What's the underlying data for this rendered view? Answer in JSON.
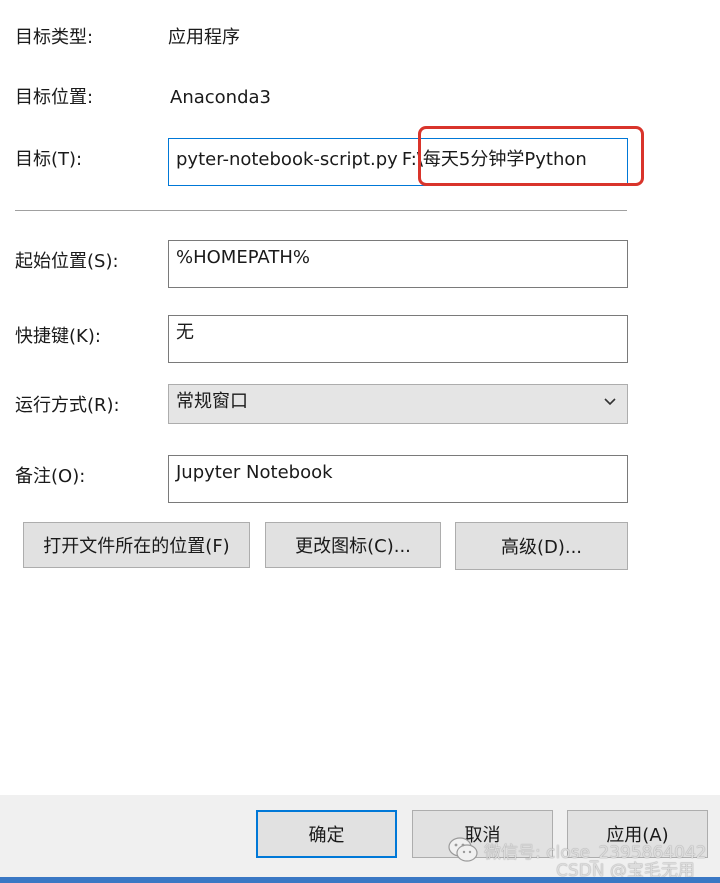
{
  "properties": {
    "target_type_label": "目标类型:",
    "target_type_value": "应用程序",
    "target_location_label": "目标位置:",
    "target_location_value": "Anaconda3",
    "target_label": "目标(T):",
    "target_value_left": "pyter-notebook-script.py",
    "target_value_right": "F:\\每天5分钟学Python",
    "start_in_label": "起始位置(S):",
    "start_in_value": "%HOMEPATH%",
    "shortcut_key_label": "快捷键(K):",
    "shortcut_key_value": "无",
    "run_label": "运行方式(R):",
    "run_value": "常规窗口",
    "comment_label": "备注(O):",
    "comment_value": "Jupyter Notebook"
  },
  "buttons": {
    "open_location": "打开文件所在的位置(F)",
    "change_icon": "更改图标(C)...",
    "advanced": "高级(D)...",
    "ok": "确定",
    "cancel": "取消",
    "apply": "应用(A)"
  },
  "watermark": {
    "wechat": "微信号: close_2395864042",
    "csdn": "CSDN @宝毛无用"
  },
  "colors": {
    "highlight": "#d9342b",
    "focus_border": "#0078d7"
  }
}
